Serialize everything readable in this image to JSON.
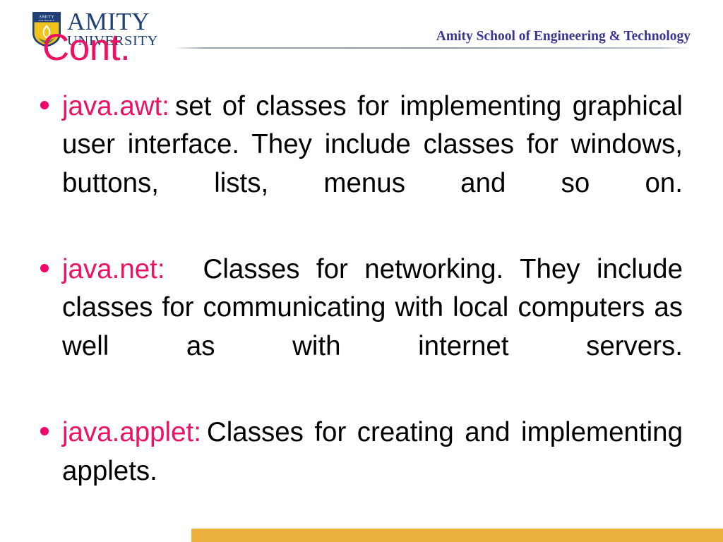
{
  "slide": {
    "title": "Cont.",
    "title_color": "#ED1164",
    "background_color": "#FFFFFF"
  },
  "header": {
    "logo": {
      "icon": "amity-shield-logo",
      "shield_top_text": "AMITY",
      "shield_sub_text": "UNIVERSITY",
      "wordmark_line1": "AMITY",
      "wordmark_line2": "UNIVERSITY",
      "navy_color": "#1F3F77",
      "gold_color": "#F1C21B"
    },
    "department_title": "Amity School of Engineering & Technology",
    "department_title_color": "#3A3694",
    "rule_color": "#8E99A6"
  },
  "content": {
    "bullets": [
      {
        "keyword": "java.awt:",
        "keyword_color": "#ED1164",
        "spacer": "small",
        "description": "set of classes for implementing graphical user interface. They include classes for windows, buttons, lists, menus and so on.",
        "bullet_marker_color": "#F2046B"
      },
      {
        "keyword": "java.net:",
        "keyword_color": "#ED1164",
        "spacer": "wide",
        "description": "Classes for networking. They include classes for communicating with local computers as well as with internet servers.",
        "bullet_marker_color": "#F2046B"
      },
      {
        "keyword": "java.applet:",
        "keyword_color": "#ED1164",
        "spacer": "small",
        "description": "Classes for creating and implementing applets.",
        "bullet_marker_color": "#F2046B"
      }
    ]
  },
  "footer": {
    "bar_color": "#EDB23D"
  }
}
